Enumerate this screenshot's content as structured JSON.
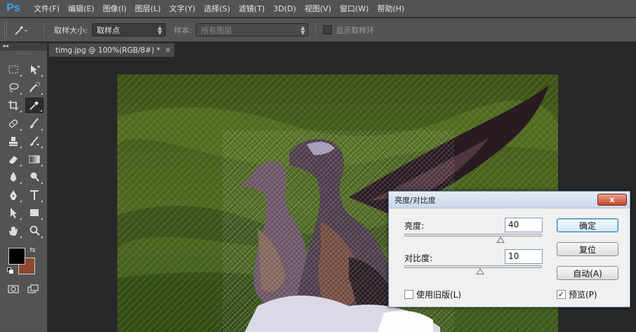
{
  "app": {
    "logo": "Ps",
    "menu": [
      "文件(F)",
      "编辑(E)",
      "图像(I)",
      "图层(L)",
      "文字(Y)",
      "选择(S)",
      "滤镜(T)",
      "3D(D)",
      "视图(V)",
      "窗口(W)",
      "帮助(H)"
    ]
  },
  "options": {
    "sample_size_label": "取样大小:",
    "sample_size_value": "取样点",
    "sample_label": "样本:",
    "sample_value": "所有图层",
    "show_ring_label": "显示取样环"
  },
  "toolbox": {
    "collapse_glyph": "◂◂",
    "tools": [
      {
        "left": "marquee-icon",
        "right": "move-icon"
      },
      {
        "left": "lasso-icon",
        "right": "quick-selection-icon"
      },
      {
        "left": "crop-icon",
        "right": "eyedropper-icon"
      },
      {
        "left": "healing-brush-icon",
        "right": "brush-icon"
      },
      {
        "left": "clone-stamp-icon",
        "right": "history-brush-icon"
      },
      {
        "left": "eraser-icon",
        "right": "gradient-icon"
      },
      {
        "left": "blur-icon",
        "right": "dodge-icon"
      },
      {
        "left": "pen-icon",
        "right": "type-icon"
      },
      {
        "left": "path-selection-icon",
        "right": "rectangle-icon"
      },
      {
        "left": "hand-icon",
        "right": "zoom-icon"
      }
    ],
    "foreground_color": "#000000",
    "background_color": "#8b4a2e"
  },
  "document": {
    "tab_title": "timg.jpg @ 100%(RGB/8#) *",
    "close_glyph": "×"
  },
  "dialog": {
    "title": "亮度/对比度",
    "close_glyph": "x",
    "brightness_label": "亮度:",
    "brightness_value": "40",
    "contrast_label": "对比度:",
    "contrast_value": "10",
    "brightness_slider_fraction": 0.7,
    "contrast_slider_fraction": 0.55,
    "ok_label": "确定",
    "reset_label": "复位",
    "auto_label": "自动(A)",
    "legacy_label": "使用旧版(L)",
    "legacy_checked": false,
    "preview_label": "预览(P)",
    "preview_checked": true,
    "check_glyph": "✓"
  }
}
